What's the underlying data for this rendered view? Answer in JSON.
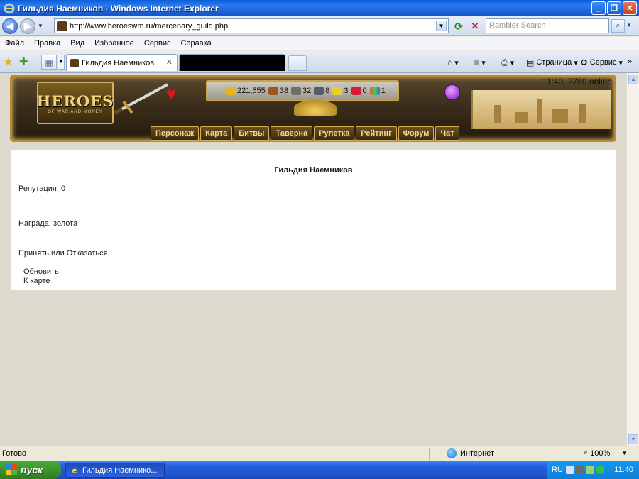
{
  "window": {
    "title": "Гильдия Наемников - Windows Internet Explorer"
  },
  "address_bar": {
    "url": "http://www.heroeswm.ru/mercenary_guild.php",
    "search_placeholder": "Rambler Search"
  },
  "menu": [
    "Файл",
    "Правка",
    "Вид",
    "Избранное",
    "Сервис",
    "Справка"
  ],
  "tabs": {
    "active_label": "Гильдия Наемников"
  },
  "command_bar": {
    "page_label": "Страница",
    "tools_label": "Сервис"
  },
  "game": {
    "logo_text": "HEROES",
    "logo_sub": "OF WAR AND MONEY",
    "clock": "11:40, 2789 online",
    "resources": [
      "221,555",
      "38",
      "32",
      "8",
      "3",
      "0",
      "1"
    ],
    "nav": [
      "Персонаж",
      "Карта",
      "Битвы",
      "Таверна",
      "Рулетка",
      "Рейтинг",
      "Форум",
      "Чат"
    ]
  },
  "page": {
    "title": "Гильдия Наемников",
    "reputation": "Репутация: 0",
    "reward": "Награда: золота",
    "prompt": "Принять или Отказаться.",
    "refresh_link": "Обновить",
    "map_link": "К карте"
  },
  "statusbar": {
    "text": "Готово",
    "zone": "Интернет",
    "zoom": "100%"
  },
  "taskbar": {
    "start_label": "пуск",
    "task_label": "Гильдия Наемнико...",
    "lang": "RU",
    "time": "11:40"
  },
  "colors": {
    "accent_gold": "#d4ad55",
    "content_border": "#5c3a1e",
    "page_bg": "#dedbce"
  }
}
